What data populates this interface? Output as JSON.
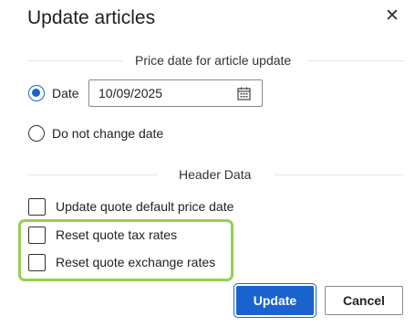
{
  "dialog": {
    "title": "Update articles",
    "close_glyph": "✕"
  },
  "price_section": {
    "header": "Price date for article update",
    "option_date_label": "Date",
    "option_date_selected": true,
    "date_value": "10/09/2025",
    "option_no_change_label": "Do not change date",
    "option_no_change_selected": false
  },
  "header_section": {
    "header": "Header Data",
    "checkboxes": [
      {
        "label": "Update quote default price date",
        "checked": false
      },
      {
        "label": "Reset quote tax rates",
        "checked": false
      },
      {
        "label": "Reset quote exchange rates",
        "checked": false
      }
    ]
  },
  "buttons": {
    "update_label": "Update",
    "cancel_label": "Cancel"
  },
  "colors": {
    "accent": "#1a63cf",
    "highlight": "#93d04f"
  },
  "icons": {
    "close": "close-icon",
    "calendar": "calendar-icon"
  }
}
